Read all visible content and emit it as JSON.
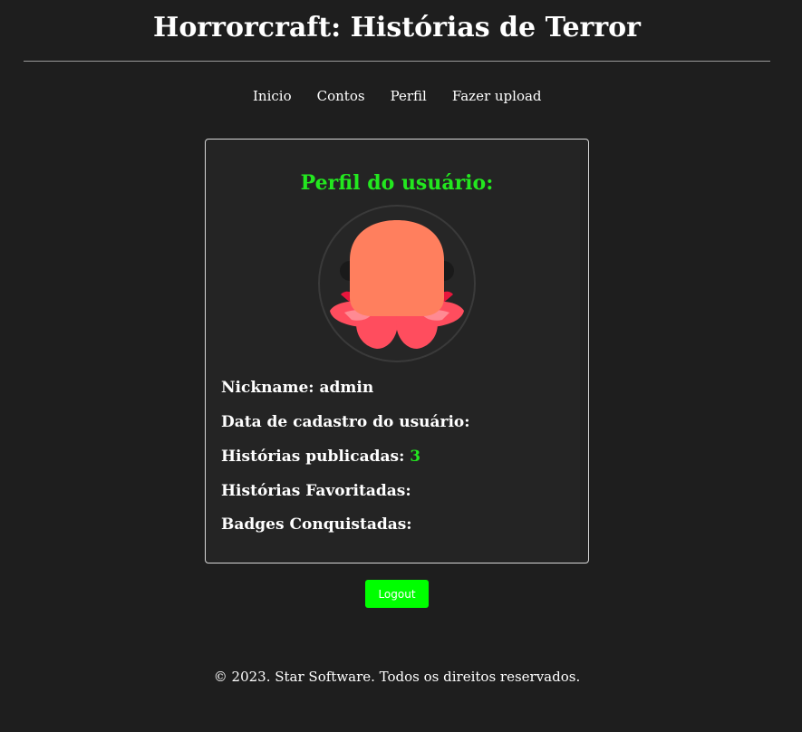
{
  "header": {
    "title": "Horrorcraft: Histórias de Terror"
  },
  "nav": {
    "items": [
      {
        "label": "Inicio"
      },
      {
        "label": "Contos"
      },
      {
        "label": "Perfil"
      },
      {
        "label": "Fazer upload"
      }
    ]
  },
  "profile": {
    "title": "Perfil do usuário:",
    "avatar_icon": "octopus-icon",
    "nickname_label": "Nickname:",
    "nickname_value": "admin",
    "signup_label": "Data de cadastro do usuário:",
    "published_label": "Histórias publicadas:",
    "published_value": "3",
    "favorites_label": "Histórias Favoritadas:",
    "badges_label": "Badges Conquistadas:"
  },
  "actions": {
    "logout_label": "Logout"
  },
  "footer": {
    "text": "© 2023. Star Software. Todos os direitos reservados."
  },
  "colors": {
    "background": "#1e1e1e",
    "accent_green": "#23e81f",
    "button_green": "#00ff00",
    "avatar_head": "#ff7f5e",
    "avatar_tentacles": "#ff4d5e"
  }
}
